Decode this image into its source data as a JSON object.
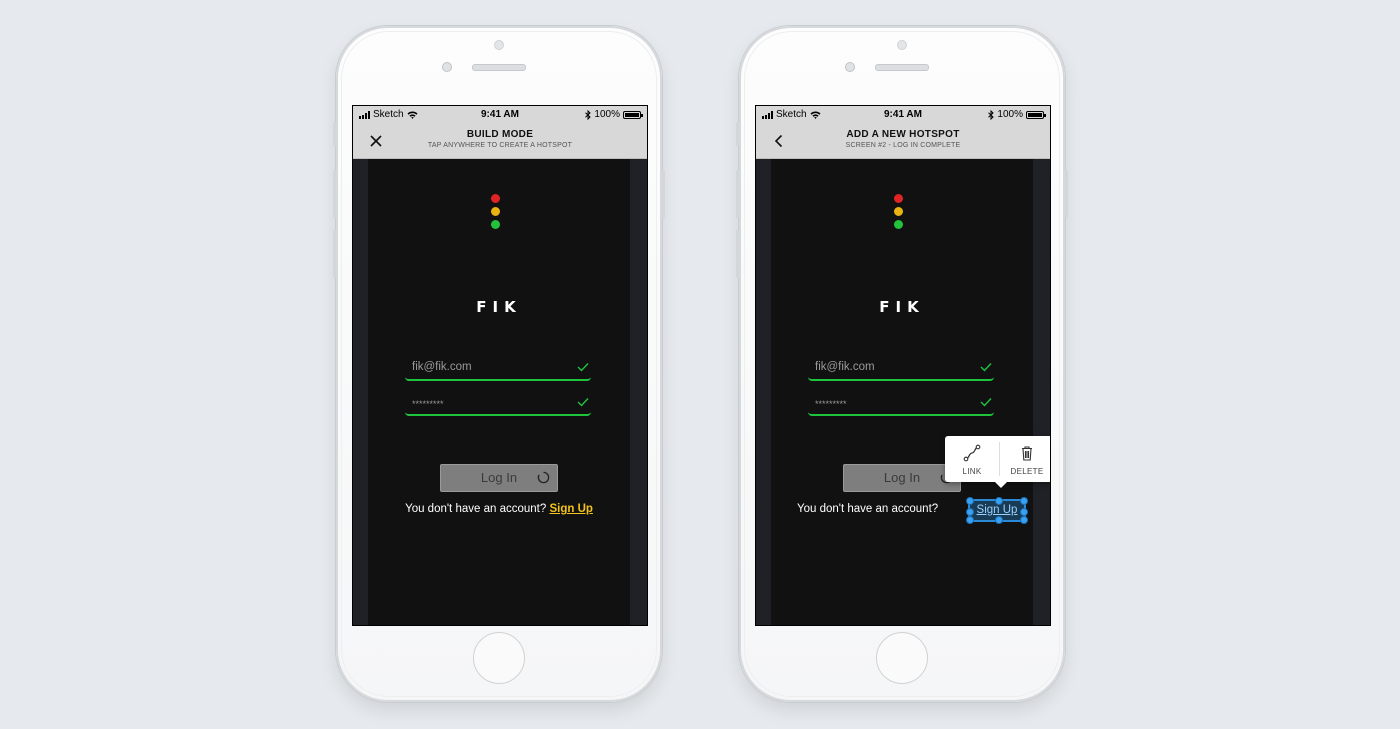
{
  "colors": {
    "dot_red": "#e02424",
    "dot_yellow": "#e8b313",
    "dot_green": "#22c23b",
    "accent_green": "#1ec43c",
    "link_yellow": "#f3c21b",
    "hotspot_blue": "#2a8ad8"
  },
  "statusbar": {
    "carrier": "Sketch",
    "time": "9:41 AM",
    "battery": "100%"
  },
  "phone_left": {
    "nav": {
      "icon": "close-icon",
      "title": "BUILD MODE",
      "subtitle": "TAP ANYWHERE TO CREATE A HOTSPOT"
    }
  },
  "phone_right": {
    "nav": {
      "icon": "back-chevron-icon",
      "title": "ADD A NEW HOTSPOT",
      "subtitle": "SCREEN #2 - LOG IN COMPLETE"
    },
    "popover": {
      "link_label": "LINK",
      "delete_label": "DELETE"
    }
  },
  "app": {
    "logo_text": "FIK",
    "email_value": "fik@fik.com",
    "password_value": "*********",
    "login_label": "Log In",
    "no_account_text": "You don't have an account?",
    "signup_label": "Sign Up"
  }
}
